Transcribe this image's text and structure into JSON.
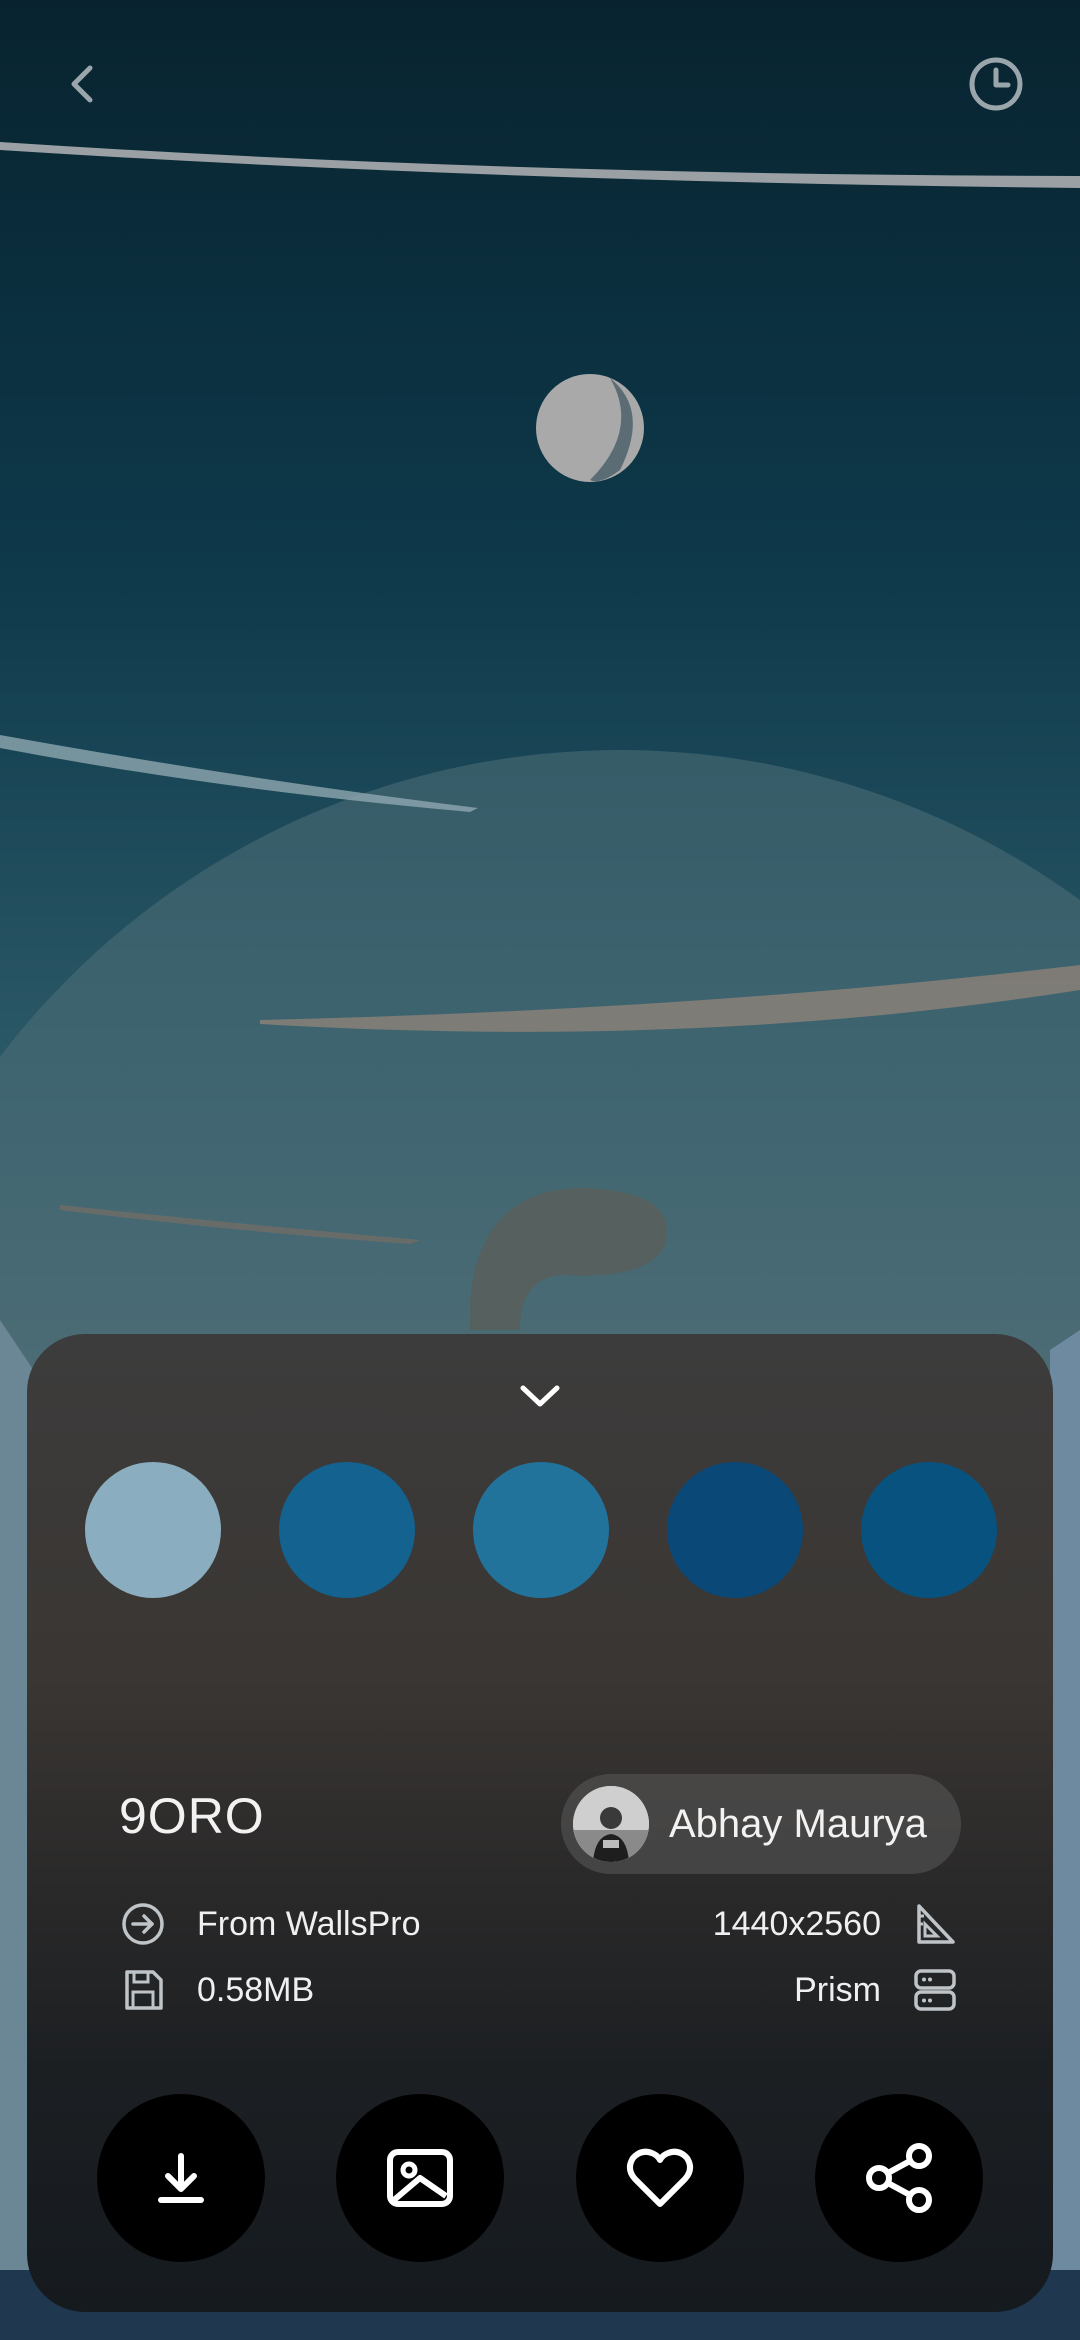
{
  "wallpaper": {
    "title": "9ORO",
    "author": "Abhay Maurya",
    "source": "From WallsPro",
    "resolution": "1440x2560",
    "size": "0.58MB",
    "provider": "Prism"
  },
  "palette": [
    "#8aadbf",
    "#13628f",
    "#22739c",
    "#0a4878",
    "#08527f"
  ],
  "icons": {
    "back": "chevron-left-icon",
    "history": "clock-icon",
    "collapse": "chevron-down-icon",
    "source": "arrow-circle-right-icon",
    "size": "floppy-disk-icon",
    "resolution": "set-square-icon",
    "provider": "server-icon",
    "download": "download-icon",
    "set_wallpaper": "image-icon",
    "favorite": "heart-icon",
    "share": "share-icon"
  }
}
